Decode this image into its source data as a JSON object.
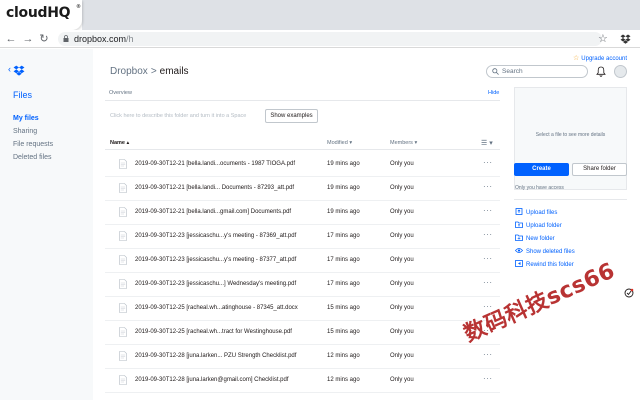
{
  "browser": {
    "brand": "cloudHQ",
    "brand_mark": "®",
    "url_host": "dropbox.com",
    "url_path": "/h"
  },
  "sidebar": {
    "title": "Files",
    "items": [
      {
        "label": "My files",
        "active": true
      },
      {
        "label": "Sharing",
        "active": false
      },
      {
        "label": "File requests",
        "active": false
      },
      {
        "label": "Deleted files",
        "active": false
      }
    ]
  },
  "header": {
    "upgrade": "Upgrade account",
    "breadcrumb_root": "Dropbox",
    "breadcrumb_sep": ">",
    "breadcrumb_current": "emails",
    "search_placeholder": "Search"
  },
  "overview": {
    "label": "Overview",
    "hide": "Hide",
    "placeholder": "Click here to describe this folder and turn it into a Space",
    "show_examples": "Show examples"
  },
  "table": {
    "col_name": "Name ▴",
    "col_modified": "Modified ▾",
    "col_members": "Members ▾",
    "view_icon": "☰ ▾",
    "more": "···",
    "rows": [
      {
        "name": "2019-09-30T12-21 [bella.landi...ocuments - 1987 TIOGA.pdf",
        "modified": "19 mins ago",
        "members": "Only you"
      },
      {
        "name": "2019-09-30T12-21 [bella.landi... Documents - 87293_att.pdf",
        "modified": "19 mins ago",
        "members": "Only you"
      },
      {
        "name": "2019-09-30T12-21 [bella.landi...gmail.com] Documents.pdf",
        "modified": "19 mins ago",
        "members": "Only you"
      },
      {
        "name": "2019-09-30T12-23 [jessicaschu...y's meeting - 87369_att.pdf",
        "modified": "17 mins ago",
        "members": "Only you"
      },
      {
        "name": "2019-09-30T12-23 [jessicaschu...y's meeting - 87377_att.pdf",
        "modified": "17 mins ago",
        "members": "Only you"
      },
      {
        "name": "2019-09-30T12-23 [jessicaschu...] Wednesday's meeting.pdf",
        "modified": "17 mins ago",
        "members": "Only you"
      },
      {
        "name": "2019-09-30T12-25 [racheal.wh...atinghouse - 87345_att.docx",
        "modified": "15 mins ago",
        "members": "Only you"
      },
      {
        "name": "2019-09-30T12-25 [racheal.wh...tract for Westinghouse.pdf",
        "modified": "15 mins ago",
        "members": "Only you"
      },
      {
        "name": "2019-09-30T12-28 [juna.larken... PZU Strength Checklist.pdf",
        "modified": "12 mins ago",
        "members": "Only you"
      },
      {
        "name": "2019-09-30T12-28 [juna.larken@gmail.com] Checklist.pdf",
        "modified": "12 mins ago",
        "members": "Only you"
      }
    ]
  },
  "details": {
    "preview_text": "Select a file to see more details",
    "create": "Create",
    "share_folder": "Share folder",
    "access": "Only you have access",
    "actions": [
      {
        "label": "Upload files",
        "icon": "upload-file-icon"
      },
      {
        "label": "Upload folder",
        "icon": "upload-folder-icon"
      },
      {
        "label": "New folder",
        "icon": "new-folder-icon"
      },
      {
        "label": "Show deleted files",
        "icon": "eye-icon"
      },
      {
        "label": "Rewind this folder",
        "icon": "rewind-icon"
      }
    ]
  },
  "watermark": "数码科技scs66",
  "colors": {
    "accent": "#0061fe",
    "muted": "#637282",
    "watermark": "#b22222"
  }
}
